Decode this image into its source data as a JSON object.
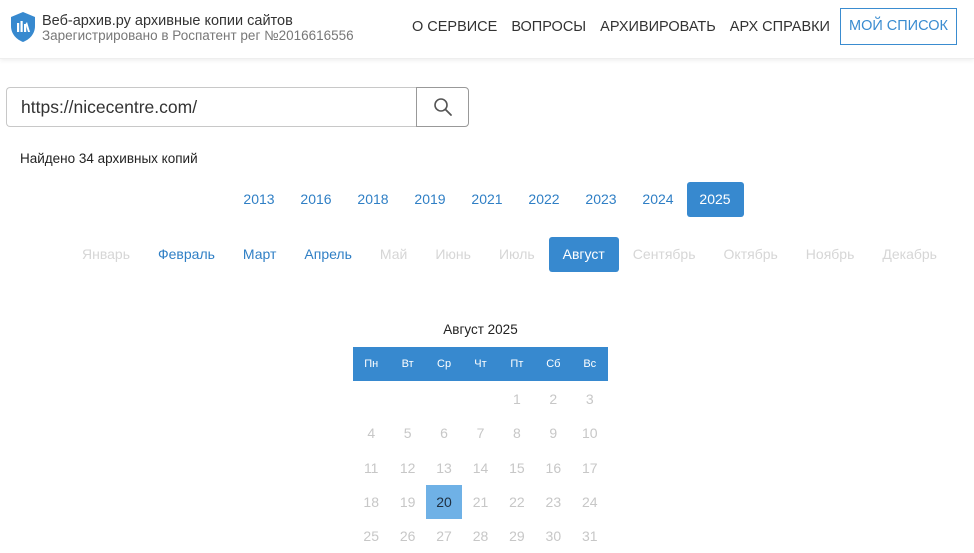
{
  "header": {
    "title": "Веб-архив.ру архивные копии сайтов",
    "subtitle": "Зарегистрировано в Роспатент рег №2016616556",
    "nav": [
      "О СЕРВИСЕ",
      "ВОПРОСЫ",
      "АРХИВИРОВАТЬ",
      "АРХ СПРАВКИ"
    ],
    "my_list": "МОЙ СПИСОК",
    "brand_color": "#3789cf"
  },
  "search": {
    "value": "https://nicecentre.com/",
    "icon": "search-icon"
  },
  "found_text": "Найдено 34 архивных копий",
  "years": [
    "2013",
    "2016",
    "2018",
    "2019",
    "2021",
    "2022",
    "2023",
    "2024",
    "2025"
  ],
  "selected_year": "2025",
  "months": [
    {
      "label": "Январь",
      "available": false
    },
    {
      "label": "Февраль",
      "available": true
    },
    {
      "label": "Март",
      "available": true
    },
    {
      "label": "Апрель",
      "available": true
    },
    {
      "label": "Май",
      "available": false
    },
    {
      "label": "Июнь",
      "available": false
    },
    {
      "label": "Июль",
      "available": false
    },
    {
      "label": "Август",
      "available": true,
      "active": true
    },
    {
      "label": "Сентябрь",
      "available": false
    },
    {
      "label": "Октябрь",
      "available": false
    },
    {
      "label": "Ноябрь",
      "available": false
    },
    {
      "label": "Декабрь",
      "available": false
    }
  ],
  "calendar": {
    "title": "Август 2025",
    "weekdays": [
      "Пн",
      "Вт",
      "Ср",
      "Чт",
      "Пт",
      "Сб",
      "Вс"
    ],
    "leading_blanks": 4,
    "days": [
      "1",
      "2",
      "3",
      "4",
      "5",
      "6",
      "7",
      "8",
      "9",
      "10",
      "11",
      "12",
      "13",
      "14",
      "15",
      "16",
      "17",
      "18",
      "19",
      "20",
      "21",
      "22",
      "23",
      "24",
      "25",
      "26",
      "27",
      "28",
      "29",
      "30",
      "31"
    ],
    "snapshot_days": [
      "20"
    ]
  }
}
